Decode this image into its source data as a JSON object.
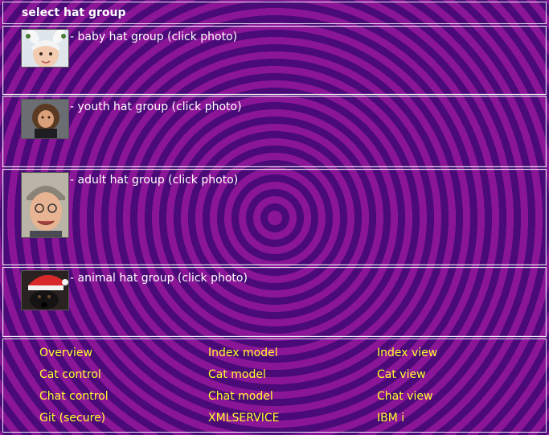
{
  "header": {
    "title": "select hat group"
  },
  "groups": [
    {
      "caption": "- baby hat group (click photo)",
      "photo_alt": "baby photo"
    },
    {
      "caption": "- youth hat group (click photo)",
      "photo_alt": "youth photo"
    },
    {
      "caption": "- adult hat group (click photo)",
      "photo_alt": "adult photo"
    },
    {
      "caption": "- animal hat group (click photo)",
      "photo_alt": "dog photo"
    }
  ],
  "nav": {
    "links": [
      "Overview",
      "Index model",
      "Index view",
      "Cat control",
      "Cat model",
      "Cat view",
      "Chat control",
      "Chat model",
      "Chat view",
      "Git (secure)",
      "XMLSERVICE",
      "IBM i"
    ]
  },
  "colors": {
    "ring_light": "#8a1596",
    "ring_dark": "#4a0a78",
    "link": "#ffff2e",
    "text": "#ffffff",
    "border": "#e8e8f0"
  }
}
